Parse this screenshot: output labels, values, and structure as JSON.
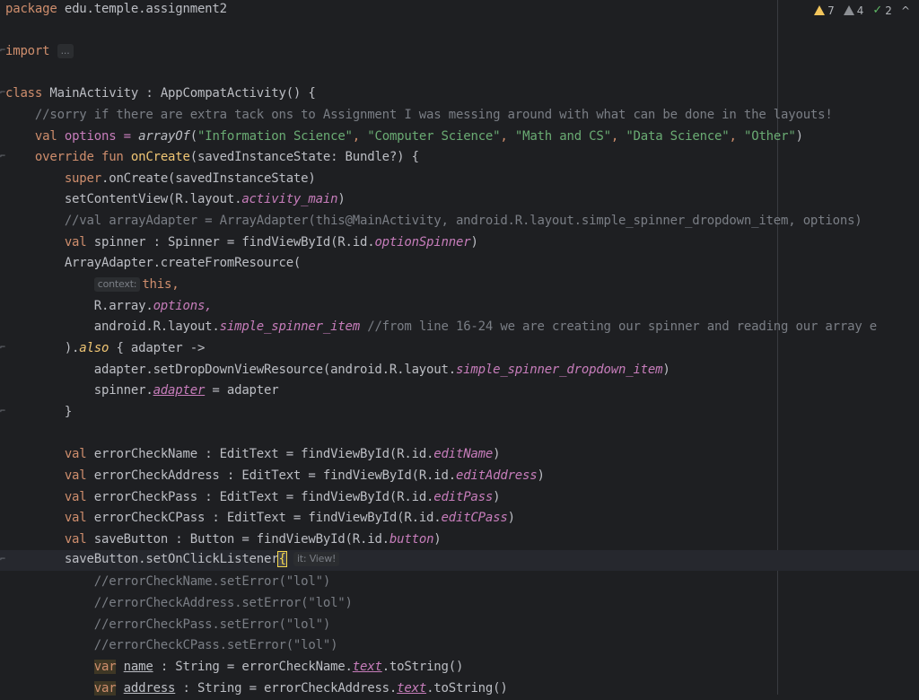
{
  "lines": {
    "l1_pkg": "package",
    "l1_rest": " edu.temple.assignment2",
    "l3_import": "import",
    "l3_dots": "...",
    "l5_class": "class",
    "l5_rest": " MainActivity : AppCompatActivity() {",
    "l6": "    //sorry if there are extra tack ons to Assignment I was messing around with what can be done in the layouts!",
    "l7_val": "    val",
    "l7_options": " options = ",
    "l7_fn": "arrayOf",
    "l7_open": "(",
    "l7_s1": "\"Information Science\"",
    "l7_s2": "\"Computer Science\"",
    "l7_s3": "\"Math and CS\"",
    "l7_s4": "\"Data Science\"",
    "l7_s5": "\"Other\"",
    "l7_close": ")",
    "l8_override": "    override fun",
    "l8_fn": " onCreate",
    "l8_rest": "(savedInstanceState: Bundle?) {",
    "l9_super": "        super",
    "l9_rest": ".onCreate(savedInstanceState)",
    "l10_a": "        setContentView(R.layout.",
    "l10_b": "activity_main",
    "l10_c": ")",
    "l11": "        //val arrayAdapter = ArrayAdapter(this@MainActivity, android.R.layout.simple_spinner_dropdown_item, options)",
    "l12_val": "        val",
    "l12_a": " spinner : Spinner = findViewById(R.id.",
    "l12_b": "optionSpinner",
    "l12_c": ")",
    "l13": "        ArrayAdapter.createFromResource(",
    "l14_hint": "context:",
    "l14_this": "this,",
    "l15_a": "            R.array.",
    "l15_b": "options,",
    "l16_a": "            android.R.layout.",
    "l16_b": "simple_spinner_item",
    "l16_c": " //from line 16-24 we are creating our spinner and reading our array e",
    "l17_a": "        ).",
    "l17_also": "also",
    "l17_b": " { adapter ->",
    "l18_a": "            adapter.setDropDownViewResource(android.R.layout.",
    "l18_b": "simple_spinner_dropdown_item",
    "l18_c": ")",
    "l19_a": "            spinner.",
    "l19_b": "adapter",
    "l19_c": " = adapter",
    "l20": "        }",
    "l22_val": "        val",
    "l22_a": " errorCheckName : EditText = findViewById(R.id.",
    "l22_b": "editName",
    "l22_c": ")",
    "l23_val": "        val",
    "l23_a": " errorCheckAddress : EditText = findViewById(R.id.",
    "l23_b": "editAddress",
    "l23_c": ")",
    "l24_val": "        val",
    "l24_a": " errorCheckPass : EditText = findViewById(R.id.",
    "l24_b": "editPass",
    "l24_c": ")",
    "l25_val": "        val",
    "l25_a": " errorCheckCPass : EditText = findViewById(R.id.",
    "l25_b": "editCPass",
    "l25_c": ")",
    "l26_val": "        val",
    "l26_a": " saveButton : Button = findViewById(R.id.",
    "l26_b": "button",
    "l26_c": ")",
    "l27_a": "        saveButton.setOnClickListener",
    "l27_brace": "{",
    "l27_hint": "it: View!",
    "l28": "            //errorCheckName.setError(\"lol\")",
    "l29": "            //errorCheckAddress.setError(\"lol\")",
    "l30": "            //errorCheckPass.setError(\"lol\")",
    "l31": "            //errorCheckCPass.setError(\"lol\")",
    "l32_indent": "            ",
    "l32_var": "var",
    "l32_sp": " ",
    "l32_name": "name",
    "l32_a": " : String = errorCheckName.",
    "l32_b": "text",
    "l32_c": ".toString()",
    "l33_indent": "            ",
    "l33_var": "var",
    "l33_sp": " ",
    "l33_name": "address",
    "l33_a": " : String = errorCheckAddress.",
    "l33_b": "text",
    "l33_c": ".toString()"
  },
  "comma": ", ",
  "status": {
    "warnings_count": "7",
    "weak_warnings_count": "4",
    "ok_count": "2",
    "collapse_icon": "^"
  }
}
